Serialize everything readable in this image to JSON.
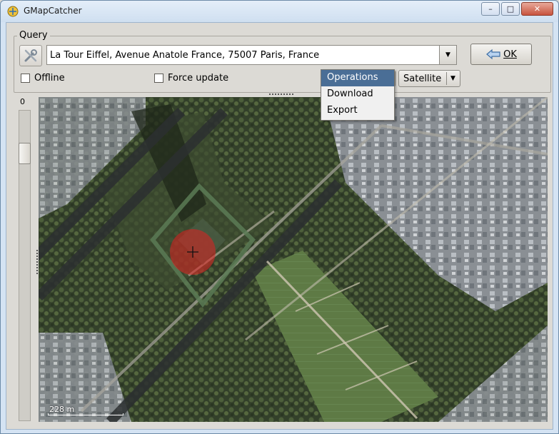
{
  "window": {
    "title": "GMapCatcher",
    "min_glyph": "–",
    "max_glyph": "□",
    "close_glyph": "✕"
  },
  "query": {
    "frame_label": "Query",
    "location_value": "La Tour Eiffel, Avenue Anatole France, 75007 Paris, France",
    "ok_label": "OK",
    "offline_label": "Offline",
    "force_update_label": "Force update"
  },
  "operations_menu": {
    "items": [
      "Operations",
      "Download",
      "Export"
    ],
    "selected": "Operations"
  },
  "map_type": {
    "selected": "Satellite"
  },
  "zoom": {
    "value": "0"
  },
  "map": {
    "scale_label": "228 m",
    "marker_color": "#e02020"
  },
  "colors": {
    "menu_highlight": "#4a6e96"
  }
}
